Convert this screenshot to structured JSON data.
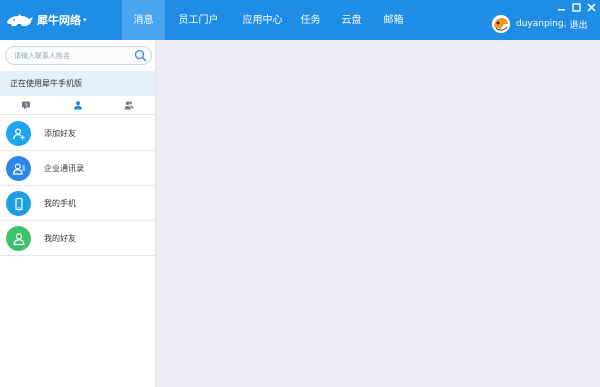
{
  "app": {
    "title": "犀牛网络",
    "caret": "▾"
  },
  "nav": [
    {
      "label": "消息",
      "active": true
    },
    {
      "label": "员工门户",
      "active": false
    },
    {
      "label": "应用中心",
      "active": false
    },
    {
      "label": "任务",
      "active": false
    },
    {
      "label": "云盘",
      "active": false
    },
    {
      "label": "邮箱",
      "active": false
    }
  ],
  "user": {
    "name": "duyanping,",
    "logout": "退出"
  },
  "search": {
    "placeholder": "请输入联系人姓名",
    "value": ""
  },
  "banner": {
    "text": "正在使用犀牛手机版"
  },
  "tabs": [
    {
      "icon": "recent-chat-icon"
    },
    {
      "icon": "contact-person-icon"
    },
    {
      "icon": "group-icon"
    }
  ],
  "list": [
    {
      "label": "添加好友",
      "icon": "add-friend-icon",
      "color": "#1fa4ef"
    },
    {
      "label": "企业通讯录",
      "icon": "enterprise-contacts-icon",
      "color": "#2d86e8"
    },
    {
      "label": "我的手机",
      "icon": "phone-icon",
      "color": "#1f9fe3"
    },
    {
      "label": "我的好友",
      "icon": "friends-icon",
      "color": "#3ec16b"
    }
  ],
  "colors": {
    "topbar": "#1f8ce6",
    "nav_active": "#4aa6f0",
    "main_bg": "#ececf2"
  }
}
